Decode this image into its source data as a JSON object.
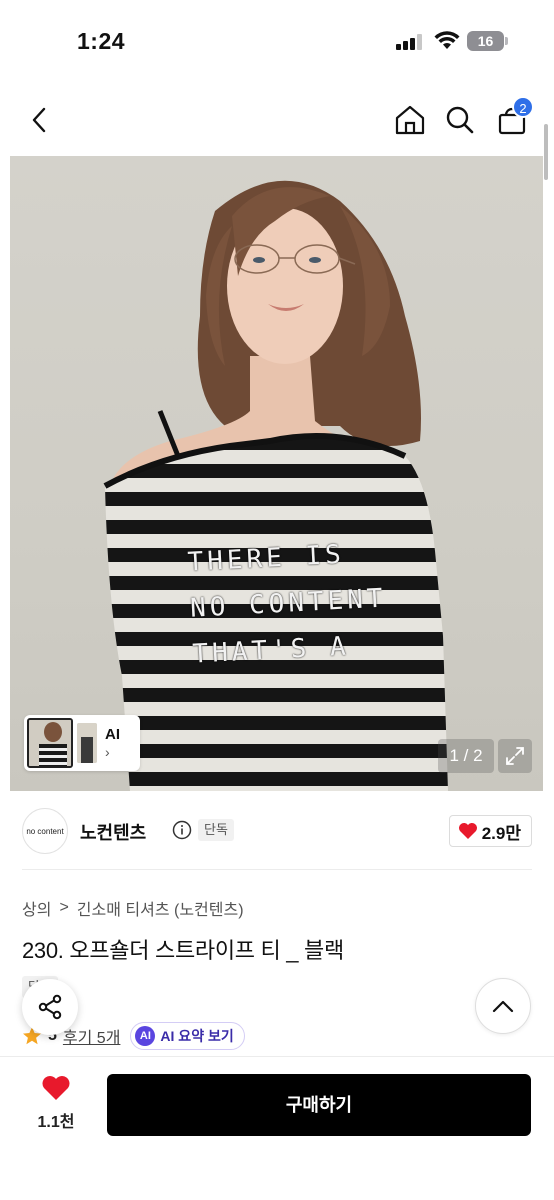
{
  "status_bar": {
    "time": "1:24",
    "battery": "16"
  },
  "nav": {
    "cart_badge": "2"
  },
  "gallery": {
    "page_indicator": "1 / 2",
    "thumb_label": "AI",
    "thumb_chevron": "›",
    "shirt_print": [
      "THERE IS",
      "NO CONTENT",
      "THAT'S A"
    ]
  },
  "brand": {
    "logo_text": "no content",
    "name": "노컨텐츠",
    "badge": "단독",
    "like_count": "2.9만"
  },
  "breadcrumb": {
    "category": "상의",
    "separator": ">",
    "subcategory": "긴소매 티셔츠 (노컨텐츠)"
  },
  "product": {
    "title": "230. 오프숄더 스트라이프 티 _ 블랙",
    "tags": [
      "단독"
    ],
    "rating": "5",
    "review_link": "후기 5개",
    "ai_summary_icon": "AI",
    "ai_summary_label": "AI 요약 보기"
  },
  "bottom_bar": {
    "wish_count": "1.1천",
    "buy_label": "구매하기"
  },
  "colors": {
    "accent_blue": "#2f6fe8",
    "heart_red": "#e8192c",
    "ai_purple": "#5a45e0",
    "star_orange": "#f5a623"
  },
  "icons": [
    "back-icon",
    "home-icon",
    "search-icon",
    "cart-icon",
    "expand-icon",
    "info-icon",
    "heart-icon",
    "share-icon",
    "chevron-up-icon",
    "star-icon"
  ]
}
